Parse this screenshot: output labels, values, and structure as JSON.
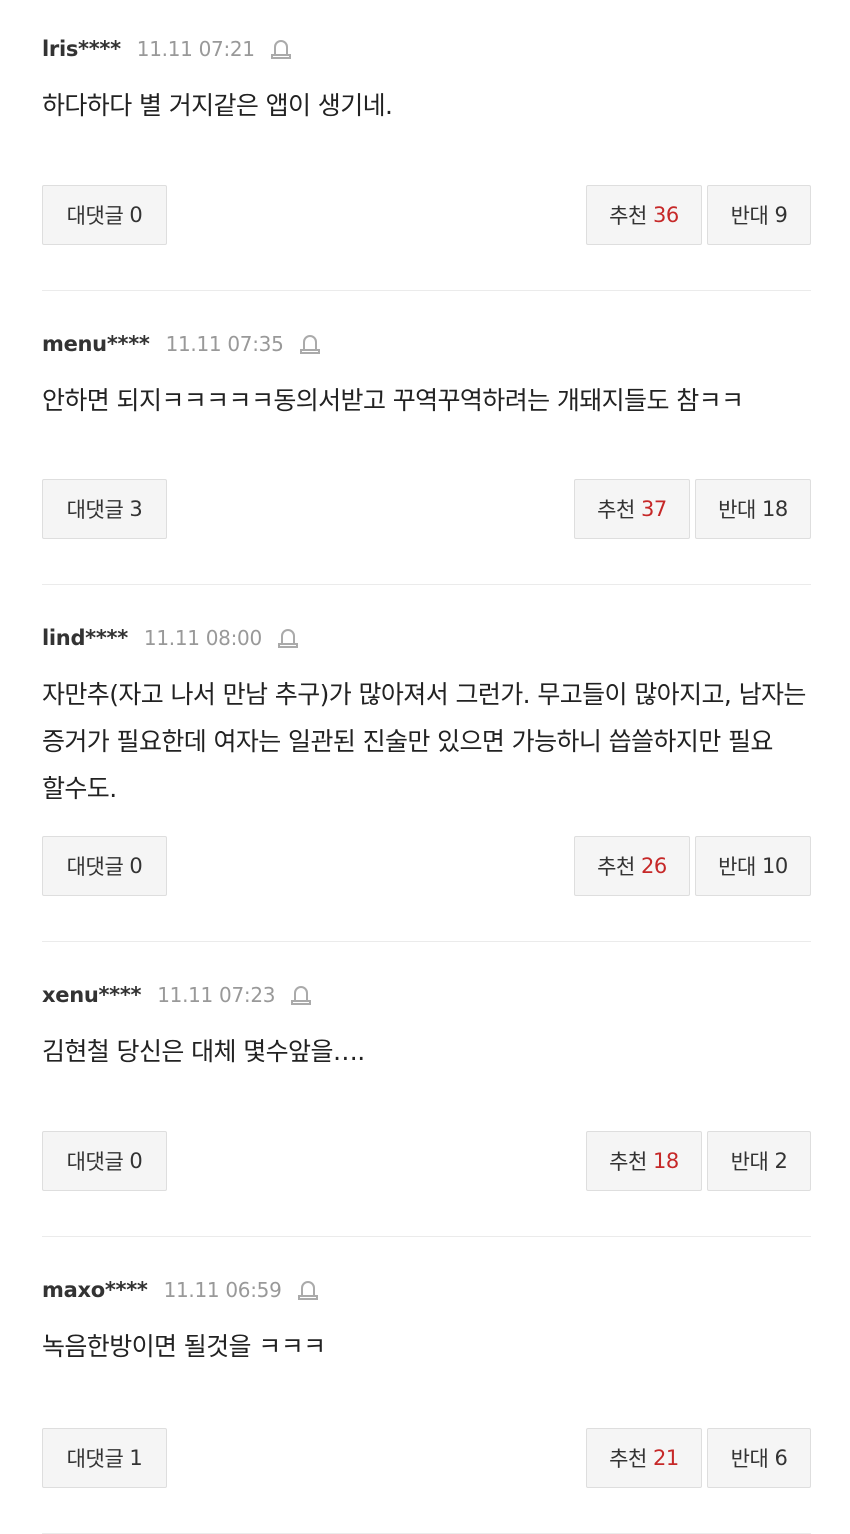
{
  "labels": {
    "reply": "대댓글",
    "like": "추천",
    "dislike": "반대"
  },
  "colors": {
    "count_red": "#c62828",
    "button_bg": "#f5f5f5",
    "border": "#dedede"
  },
  "icons": {
    "report": "bell-icon"
  },
  "comments": [
    {
      "author": "lris****",
      "time": "11.11 07:21",
      "text": "하다하다 별 거지같은 앱이 생기네.",
      "replies": "0",
      "likes": "36",
      "dislikes": "9"
    },
    {
      "author": "menu****",
      "time": "11.11 07:35",
      "text": "안하면 되지ㅋㅋㅋㅋㅋ동의서받고 꾸역꾸역하려는 개돼지들도 참ㅋㅋ",
      "replies": "3",
      "likes": "37",
      "dislikes": "18"
    },
    {
      "author": "lind****",
      "time": "11.11 08:00",
      "text": "자만추(자고 나서 만남 추구)가 많아져서 그런가. 무고들이 많아지고, 남자는 증거가 필요한데 여자는 일관된 진술만 있으면 가능하니 씁쓸하지만 필요 할수도.",
      "replies": "0",
      "likes": "26",
      "dislikes": "10"
    },
    {
      "author": "xenu****",
      "time": "11.11 07:23",
      "text": "김현철 당신은 대체 몇수앞을….",
      "replies": "0",
      "likes": "18",
      "dislikes": "2"
    },
    {
      "author": "maxo****",
      "time": "11.11 06:59",
      "text": "녹음한방이면 될것을 ㅋㅋㅋ",
      "replies": "1",
      "likes": "21",
      "dislikes": "6"
    }
  ]
}
